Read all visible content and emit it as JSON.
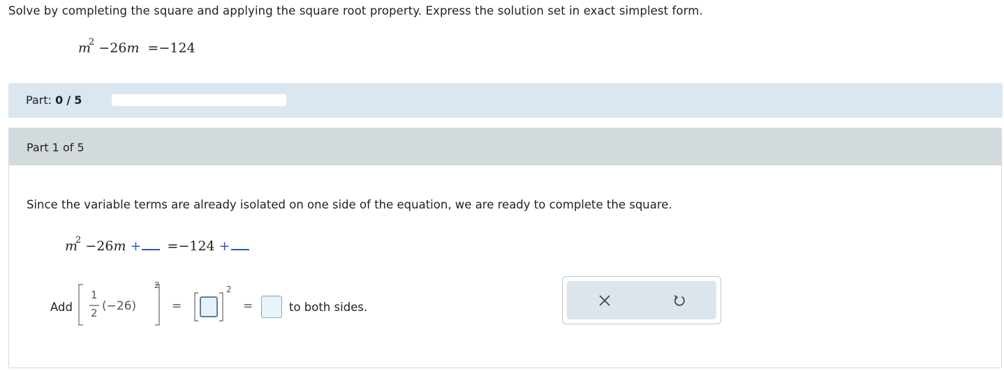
{
  "problem": {
    "instruction": "Solve by completing the square and applying the square root property. Express the solution set in exact simplest form.",
    "equation": {
      "var": "m",
      "exp": "2",
      "minus": "−",
      "coef": "26",
      "equals": "=",
      "neg": "−",
      "rhs": "124"
    }
  },
  "progress": {
    "label": "Part:",
    "current": "0",
    "sep": "/",
    "total": "5",
    "fill_fraction": 0.0,
    "fill_color": "#2b7cd3"
  },
  "part": {
    "header": "Part 1 of 5",
    "explanation": "Since the variable terms are already isolated on one side of the equation, we are ready to complete the square.",
    "step_equation": {
      "var": "m",
      "exp": "2",
      "minus": "−",
      "coef": "26",
      "plus": "+",
      "equals": "=",
      "neg": "−",
      "rhs": "124",
      "plus2": "+"
    },
    "add_label": "Add",
    "fraction_num": "1",
    "fraction_den": "2",
    "factor": "(−26)",
    "exp": "2",
    "equals": "=",
    "tail_label": "to both sides."
  },
  "toolbar": {
    "clear_icon": "close-icon",
    "undo_icon": "undo-icon"
  },
  "colors": {
    "accent_blue": "#2855c8",
    "progress_bg": "#dae6f0",
    "header_bg": "#d3dadd"
  }
}
